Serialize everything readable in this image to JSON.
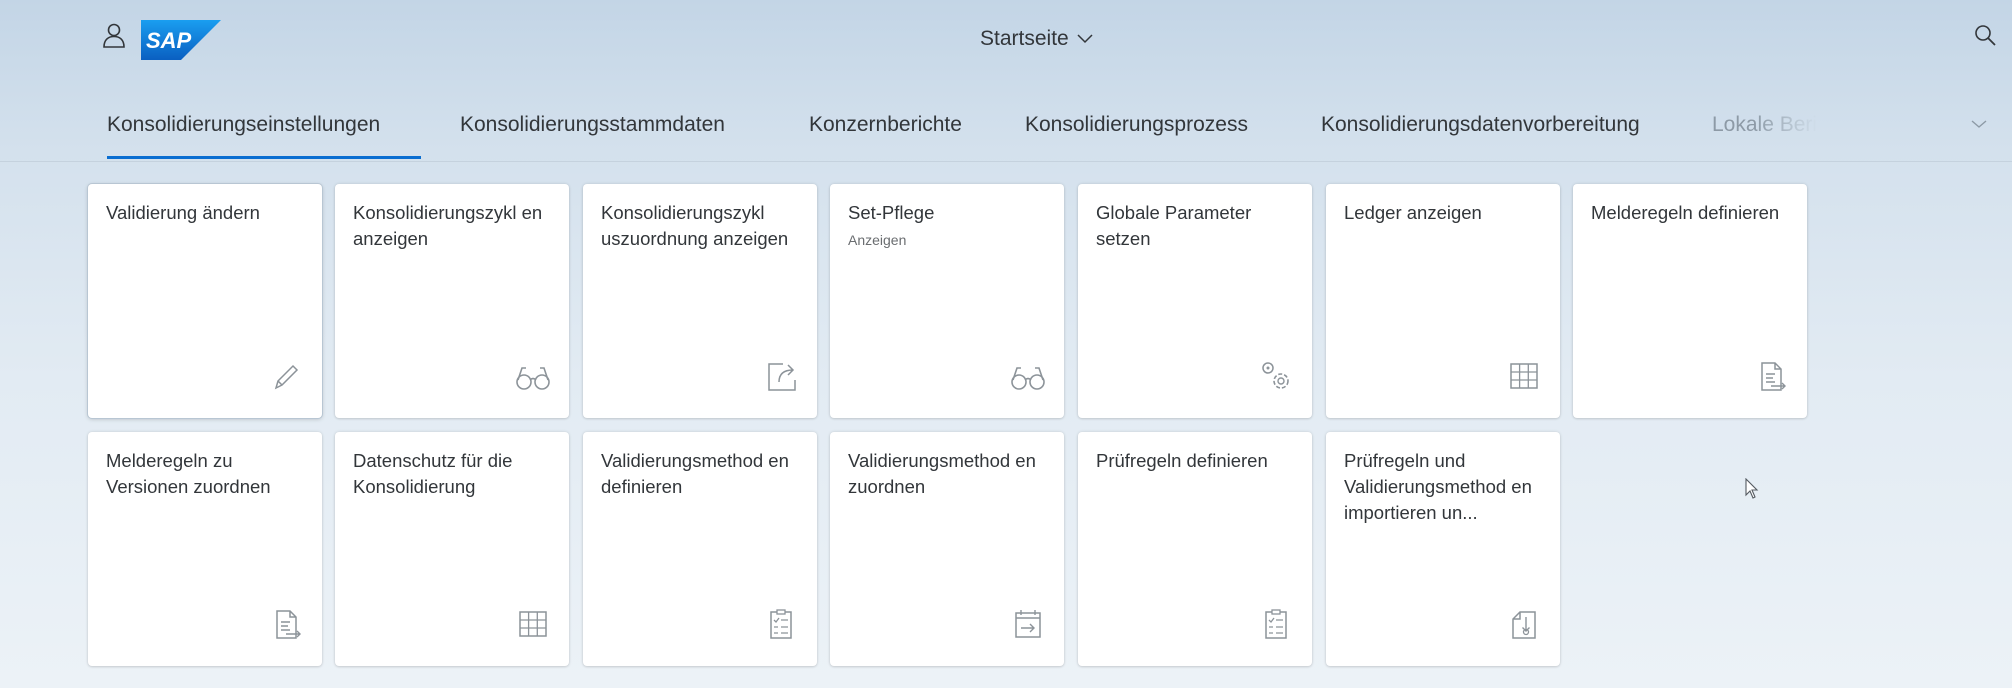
{
  "shell": {
    "logo_text": "SAP",
    "title": "Startseite",
    "brand_color": "#0a6ed1"
  },
  "tabs": [
    {
      "label": "Konsolidierungseinstellungen",
      "selected": true
    },
    {
      "label": "Konsolidierungsstammdaten",
      "selected": false
    },
    {
      "label": "Konzernberichte",
      "selected": false
    },
    {
      "label": "Konsolidierungsprozess",
      "selected": false
    },
    {
      "label": "Konsolidierungsdatenvorbereitung",
      "selected": false
    },
    {
      "label": "Lokale Beri",
      "selected": false
    }
  ],
  "tiles": [
    {
      "title": "Validierung ändern",
      "subtitle": "",
      "icon": "pencil-icon"
    },
    {
      "title": "Konsolidierungszykl en anzeigen",
      "subtitle": "",
      "icon": "glasses-icon"
    },
    {
      "title": "Konsolidierungszykl uszuordnung anzeigen",
      "subtitle": "",
      "icon": "share-icon"
    },
    {
      "title": "Set-Pflege",
      "subtitle": "Anzeigen",
      "icon": "glasses-icon"
    },
    {
      "title": "Globale Parameter setzen",
      "subtitle": "",
      "icon": "gears-icon"
    },
    {
      "title": "Ledger anzeigen",
      "subtitle": "",
      "icon": "grid-table-icon"
    },
    {
      "title": "Melderegeln definieren",
      "subtitle": "",
      "icon": "document-export-icon"
    },
    {
      "title": "Melderegeln zu Versionen zuordnen",
      "subtitle": "",
      "icon": "document-export-icon"
    },
    {
      "title": "Datenschutz für die Konsolidierung",
      "subtitle": "",
      "icon": "grid-table-icon"
    },
    {
      "title": "Validierungsmethod en definieren",
      "subtitle": "",
      "icon": "checklist-icon"
    },
    {
      "title": "Validierungsmethod en zuordnen",
      "subtitle": "",
      "icon": "calendar-arrow-icon"
    },
    {
      "title": "Prüfregeln definieren",
      "subtitle": "",
      "icon": "checklist-icon"
    },
    {
      "title": "Prüfregeln und Validierungsmethod en importieren un...",
      "subtitle": "",
      "icon": "document-import-icon"
    }
  ]
}
